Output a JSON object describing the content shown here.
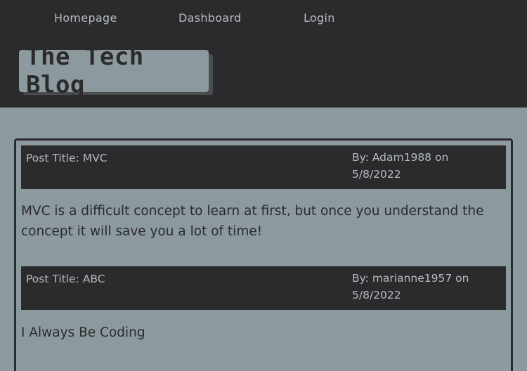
{
  "nav": {
    "home": "Homepage",
    "dashboard": "Dashboard",
    "login": "Login"
  },
  "site_title": "The Tech Blog",
  "posts": [
    {
      "title": "Post Title: MVC",
      "meta_line1": "By: Adam1988 on",
      "meta_line2": "5/8/2022",
      "body": "MVC is a difficult concept to learn at first, but once you understand the concept it will save you a lot of time!"
    },
    {
      "title": "Post Title: ABC",
      "meta_line1": "By: marianne1957 on",
      "meta_line2": "5/8/2022",
      "body": "I Always Be Coding"
    }
  ],
  "colors": {
    "header_bg": "#2b2b2d",
    "page_bg": "#8c999f",
    "nav_text": "#b4bbbe"
  }
}
